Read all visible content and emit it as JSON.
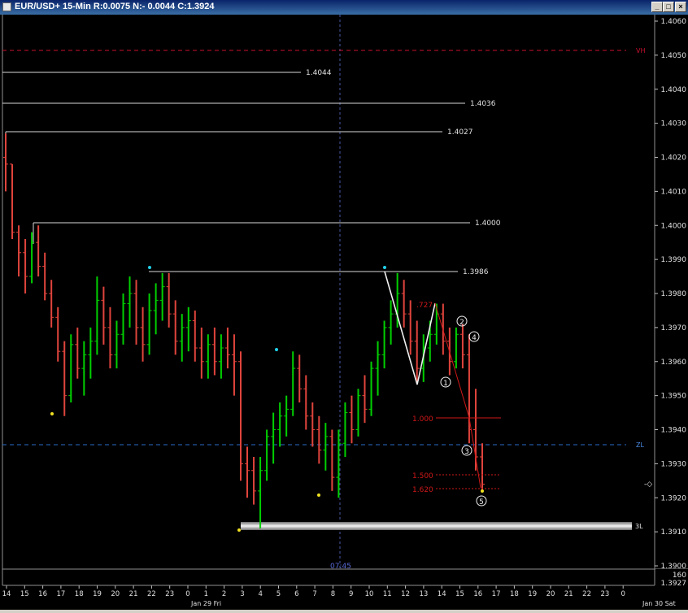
{
  "window": {
    "title": "EUR/USD+ 15-Min R:0.0075 N:- 0.0044 C:1.3924",
    "buttons": {
      "minimize": "_",
      "maximize": "□",
      "close": "×"
    }
  },
  "colors": {
    "background": "#000000",
    "up_bar": "#00d000",
    "down_bar": "#e0443c",
    "level_line": "#d8d8d8",
    "vh_line": "#c8102e",
    "zl_line": "#2a6cc8",
    "fib_red": "#d01818",
    "cyan_marker": "#20d0e8",
    "yellow_marker": "#f0e020"
  },
  "price_axis": {
    "ticks": [
      "1.4060",
      "1.4050",
      "1.4040",
      "1.4030",
      "1.4020",
      "1.4010",
      "1.4000",
      "1.3990",
      "1.3980",
      "1.3970",
      "1.3960",
      "1.3950",
      "1.3940",
      "1.3930",
      "1.3920",
      "1.3910",
      "1.3900"
    ],
    "readout_count": "160",
    "readout_price": "1.3927",
    "pointer_glyph": "-◇"
  },
  "time_axis": {
    "hour_labels": [
      "14",
      "15",
      "16",
      "17",
      "18",
      "19",
      "20",
      "21",
      "22",
      "23",
      "0",
      "1",
      "2",
      "3",
      "4",
      "5",
      "6",
      "7",
      "8",
      "9",
      "10",
      "11",
      "12",
      "13",
      "14",
      "15",
      "16",
      "17",
      "18",
      "19",
      "20",
      "21",
      "22",
      "23",
      "0"
    ],
    "date_labels": [
      "Jan 29 Fri",
      "Jan 30 Sat"
    ],
    "cursor_time": "07:45"
  },
  "levels": {
    "vh": "VH",
    "zl": "ZL",
    "three_l": "3L",
    "l_14044": "1.4044",
    "l_14036": "1.4036",
    "l_14027": "1.4027",
    "l_14000": "1.4000",
    "l_13986": "1.3986"
  },
  "fib": {
    "r_727": ".727",
    "r_1000": "1.000",
    "r_1500": "1.500",
    "r_1620": "1.620"
  },
  "waves": [
    "1",
    "2",
    "3",
    "4",
    "5"
  ],
  "chart_data": {
    "type": "candlestick",
    "symbol": "EUR/USD+",
    "timeframe": "15-Min",
    "last_close": 1.3924,
    "ylim": [
      1.39,
      1.406
    ],
    "bars": [
      [
        1.402,
        1.4027,
        1.401,
        1.4018
      ],
      [
        1.4018,
        1.4018,
        1.3996,
        1.3998
      ],
      [
        1.3998,
        1.4,
        1.3985,
        1.3992
      ],
      [
        1.3992,
        1.3996,
        1.398,
        1.3985
      ],
      [
        1.3985,
        1.3998,
        1.3983,
        1.3995
      ],
      [
        1.3995,
        1.4,
        1.3985,
        1.3988
      ],
      [
        1.3988,
        1.3992,
        1.3978,
        1.398
      ],
      [
        1.398,
        1.3984,
        1.397,
        1.3973
      ],
      [
        1.3973,
        1.3976,
        1.396,
        1.3963
      ],
      [
        1.3963,
        1.3966,
        1.3944,
        1.395
      ],
      [
        1.395,
        1.3968,
        1.3948,
        1.3965
      ],
      [
        1.3965,
        1.397,
        1.3955,
        1.3958
      ],
      [
        1.3958,
        1.3966,
        1.395,
        1.3962
      ],
      [
        1.3962,
        1.397,
        1.3955,
        1.3966
      ],
      [
        1.3966,
        1.3985,
        1.3962,
        1.3978
      ],
      [
        1.3978,
        1.3982,
        1.3965,
        1.397
      ],
      [
        1.397,
        1.3976,
        1.3958,
        1.3962
      ],
      [
        1.3962,
        1.3972,
        1.3958,
        1.3968
      ],
      [
        1.3968,
        1.398,
        1.3965,
        1.3977
      ],
      [
        1.3977,
        1.3985,
        1.397,
        1.398
      ],
      [
        1.398,
        1.3984,
        1.3965,
        1.397
      ],
      [
        1.397,
        1.3976,
        1.396,
        1.3965
      ],
      [
        1.3965,
        1.398,
        1.3962,
        1.3975
      ],
      [
        1.3975,
        1.3983,
        1.3968,
        1.3978
      ],
      [
        1.3978,
        1.3986,
        1.3972,
        1.3982
      ],
      [
        1.3982,
        1.3986,
        1.397,
        1.3974
      ],
      [
        1.3974,
        1.3978,
        1.3962,
        1.3966
      ],
      [
        1.3966,
        1.3974,
        1.396,
        1.397
      ],
      [
        1.397,
        1.3976,
        1.3963,
        1.3972
      ],
      [
        1.3972,
        1.3975,
        1.396,
        1.3964
      ],
      [
        1.3964,
        1.397,
        1.3955,
        1.396
      ],
      [
        1.396,
        1.3968,
        1.3955,
        1.3965
      ],
      [
        1.3965,
        1.397,
        1.3956,
        1.396
      ],
      [
        1.396,
        1.3968,
        1.3955,
        1.3964
      ],
      [
        1.3964,
        1.397,
        1.3958,
        1.3962
      ],
      [
        1.3962,
        1.3968,
        1.395,
        1.396
      ],
      [
        1.396,
        1.3963,
        1.3925,
        1.393
      ],
      [
        1.393,
        1.3935,
        1.392,
        1.3928
      ],
      [
        1.3928,
        1.3932,
        1.3918,
        1.3922
      ],
      [
        1.3922,
        1.3932,
        1.3911,
        1.3928
      ],
      [
        1.3928,
        1.394,
        1.3925,
        1.3938
      ],
      [
        1.3938,
        1.3945,
        1.393,
        1.394
      ],
      [
        1.394,
        1.3948,
        1.3935,
        1.3944
      ],
      [
        1.3944,
        1.395,
        1.3938,
        1.3946
      ],
      [
        1.3946,
        1.3963,
        1.3944,
        1.3958
      ],
      [
        1.3958,
        1.3962,
        1.3948,
        1.3952
      ],
      [
        1.3952,
        1.3956,
        1.394,
        1.3944
      ],
      [
        1.3944,
        1.3948,
        1.3935,
        1.394
      ],
      [
        1.394,
        1.3944,
        1.393,
        1.3934
      ],
      [
        1.3934,
        1.3942,
        1.3928,
        1.3938
      ],
      [
        1.3938,
        1.394,
        1.3922,
        1.3926
      ],
      [
        1.3926,
        1.394,
        1.392,
        1.3936
      ],
      [
        1.3936,
        1.3948,
        1.3932,
        1.3945
      ],
      [
        1.3945,
        1.395,
        1.3936,
        1.394
      ],
      [
        1.394,
        1.3952,
        1.3938,
        1.395
      ],
      [
        1.395,
        1.3956,
        1.3942,
        1.3946
      ],
      [
        1.3946,
        1.396,
        1.3944,
        1.3958
      ],
      [
        1.3958,
        1.3966,
        1.395,
        1.3962
      ],
      [
        1.3962,
        1.3972,
        1.3958,
        1.397
      ],
      [
        1.397,
        1.3978,
        1.3965,
        1.3974
      ],
      [
        1.3974,
        1.3986,
        1.397,
        1.398
      ],
      [
        1.398,
        1.3984,
        1.397,
        1.3974
      ],
      [
        1.3974,
        1.3978,
        1.3962,
        1.3966
      ],
      [
        1.3966,
        1.3972,
        1.3954,
        1.3958
      ],
      [
        1.3958,
        1.3968,
        1.3954,
        1.3964
      ],
      [
        1.3964,
        1.3972,
        1.396,
        1.3968
      ],
      [
        1.3968,
        1.3977,
        1.3965,
        1.3974
      ],
      [
        1.3974,
        1.3977,
        1.3962,
        1.3966
      ],
      [
        1.3966,
        1.397,
        1.3956,
        1.396
      ],
      [
        1.396,
        1.397,
        1.3958,
        1.3968
      ],
      [
        1.3968,
        1.3971,
        1.3958,
        1.3962
      ],
      [
        1.3962,
        1.3968,
        1.3936,
        1.394
      ],
      [
        1.394,
        1.3952,
        1.3928,
        1.3932
      ],
      [
        1.3932,
        1.3936,
        1.3922,
        1.3924
      ]
    ]
  }
}
